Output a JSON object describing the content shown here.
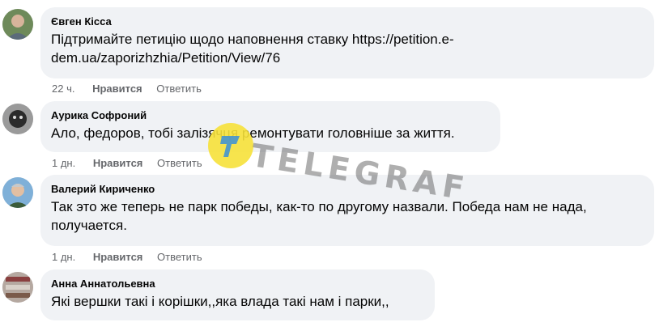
{
  "comments": [
    {
      "author": "Євген Кісса",
      "text": "Підтримайте петицію щодо наповнення ставку https://petition.e-dem.ua/zaporizhzhia/Petition/View/76",
      "time": "22 ч.",
      "like": "Нравится",
      "reply": "Ответить"
    },
    {
      "author": "Аурика Софроний",
      "text": "Ало, федоров, тобі залізячця ремонтувати головніше за життя.",
      "time": "1 дн.",
      "like": "Нравится",
      "reply": "Ответить"
    },
    {
      "author": "Валерий Кириченко",
      "text": "Так это же теперь не парк победы, как-то по другому назвали. Победа нам не нада, получается.",
      "time": "1 дн.",
      "like": "Нравится",
      "reply": "Ответить"
    },
    {
      "author": "Анна Аннатольевна",
      "text": "Які вершки такі і корішки,,яка влада такі нам і парки,,"
    }
  ],
  "watermark": {
    "text": "TELEGRAF",
    "logo_color": "#f6e13a"
  },
  "colors": {
    "bubble": "#f0f2f5",
    "meta": "#65676b"
  }
}
